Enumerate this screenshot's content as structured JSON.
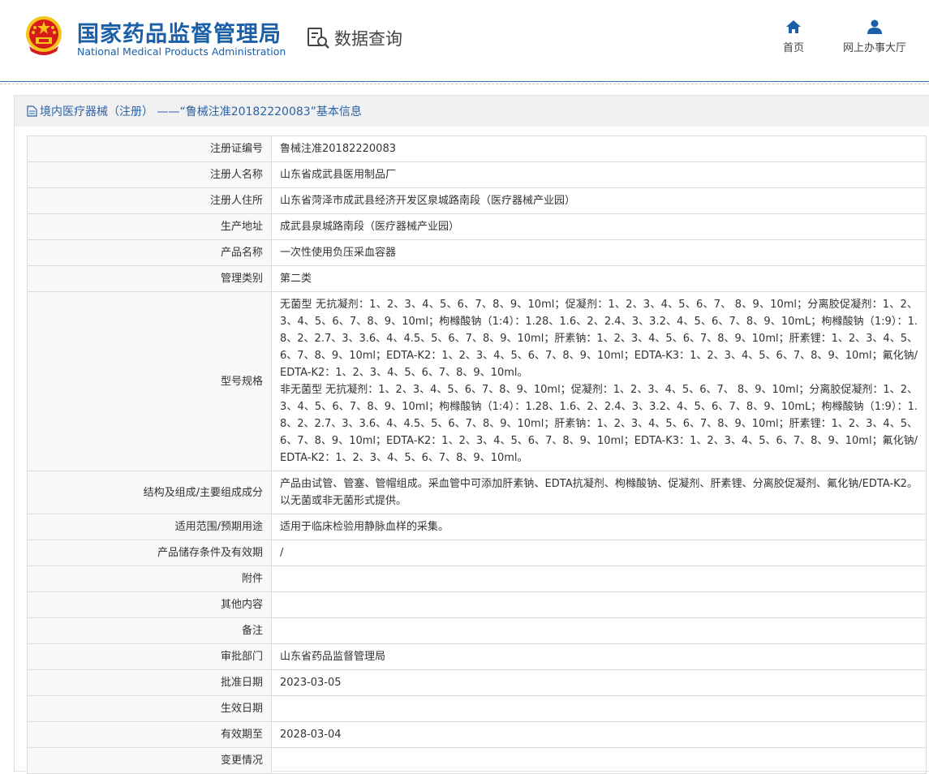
{
  "header": {
    "org_name_cn": "国家药品监督管理局",
    "org_name_en": "National Medical Products Administration",
    "query_label": "数据查询",
    "nav": [
      {
        "label": "首页",
        "icon": "home-icon"
      },
      {
        "label": "网上办事大厅",
        "icon": "user-icon"
      }
    ]
  },
  "panel": {
    "title": "境内医疗器械（注册） ——“鲁械注准20182220083”基本信息"
  },
  "rows": [
    {
      "label": "注册证编号",
      "value": "鲁械注准20182220083"
    },
    {
      "label": "注册人名称",
      "value": "山东省成武县医用制品厂"
    },
    {
      "label": "注册人住所",
      "value": "山东省菏泽市成武县经济开发区泉城路南段（医疗器械产业园）"
    },
    {
      "label": "生产地址",
      "value": "成武县泉城路南段（医疗器械产业园）"
    },
    {
      "label": "产品名称",
      "value": "一次性使用负压采血容器"
    },
    {
      "label": "管理类别",
      "value": "第二类"
    },
    {
      "label": "型号规格",
      "value": "无菌型 无抗凝剂：1、2、3、4、5、6、7、8、9、10ml；促凝剂：1、2、3、4、5、6、7、 8、9、10ml；分离胶促凝剂：1、2、3、4、5、6、7、8、9、10ml；枸橼酸钠（1:4）：1.28、1.6、2、2.4、3、3.2、4、5、6、7、8、9、10mL；枸橼酸钠（1:9）：1.8、2、2.7、3、3.6、4、4.5、5、6、7、8、9、10ml；肝素钠：1、2、3、4、5、6、7、8、9、10ml；肝素锂：1、2、3、4、5、6、7、8、9、10ml；EDTA-K2：1、2、3、4、5、6、7、8、9、10ml；EDTA-K3：1、2、3、4、5、6、7、8、9、10ml；氟化钠/EDTA-K2：1、2、3、4、5、6、7、8、9、10ml。\n非无菌型 无抗凝剂：1、2、3、4、5、6、7、8、9、10ml；促凝剂：1、2、3、4、5、6、7、 8、9、10ml；分离胶促凝剂：1、2、3、4、5、6、7、8、9、10ml；枸橼酸钠（1:4）：1.28、1.6、2、2.4、3、3.2、4、5、6、7、8、9、10mL；枸橼酸钠（1:9）：1.8、2、2.7、3、3.6、4、4.5、5、6、7、8、9、10ml；肝素钠：1、2、3、4、5、6、7、8、9、10ml；肝素锂：1、2、3、4、5、6、7、8、9、10ml；EDTA-K2：1、2、3、4、5、6、7、8、9、10ml；EDTA-K3：1、2、3、4、5、6、7、8、9、10ml；氟化钠/EDTA-K2：1、2、3、4、5、6、7、8、9、10ml。"
    },
    {
      "label": "结构及组成/主要组成成分",
      "value": "产品由试管、管塞、管帽组成。采血管中可添加肝素钠、EDTA抗凝剂、枸橼酸钠、促凝剂、肝素锂、分离胶促凝剂、氟化钠/EDTA-K2。以无菌或非无菌形式提供。"
    },
    {
      "label": "适用范围/预期用途",
      "value": "适用于临床检验用静脉血样的采集。"
    },
    {
      "label": "产品储存条件及有效期",
      "value": "/"
    },
    {
      "label": "附件",
      "value": ""
    },
    {
      "label": "其他内容",
      "value": ""
    },
    {
      "label": "备注",
      "value": ""
    },
    {
      "label": "审批部门",
      "value": "山东省药品监督管理局"
    },
    {
      "label": "批准日期",
      "value": "2023-03-05"
    },
    {
      "label": "生效日期",
      "value": ""
    },
    {
      "label": "有效期至",
      "value": "2028-03-04"
    },
    {
      "label": "变更情况",
      "value": ""
    }
  ],
  "colors": {
    "brand_blue": "#1a5fa8",
    "emblem_red": "#d71a1a",
    "emblem_gold": "#f5c518"
  }
}
